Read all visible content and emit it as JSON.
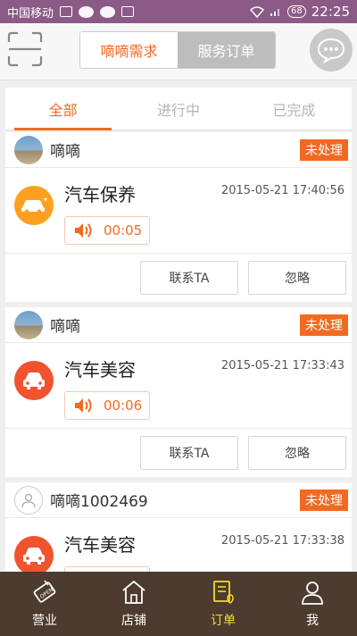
{
  "status_bar": {
    "carrier": "中国移动",
    "battery": "68",
    "time": "22:25"
  },
  "header": {
    "segments": [
      {
        "label": "嘀嘀需求",
        "active": true
      },
      {
        "label": "服务订单",
        "active": false
      }
    ]
  },
  "tabs": [
    {
      "label": "全部",
      "active": true
    },
    {
      "label": "进行中",
      "active": false
    },
    {
      "label": "已完成",
      "active": false
    }
  ],
  "orders": [
    {
      "user": "嘀嘀",
      "status": "未处理",
      "service": "汽车保养",
      "time": "2015-05-21 17:40:56",
      "voice": "00:05",
      "contact_label": "联系TA",
      "ignore_label": "忽略"
    },
    {
      "user": "嘀嘀",
      "status": "未处理",
      "service": "汽车美容",
      "time": "2015-05-21 17:33:43",
      "voice": "00:06",
      "contact_label": "联系TA",
      "ignore_label": "忽略"
    },
    {
      "user": "嘀嘀1002469",
      "status": "未处理",
      "service": "汽车美容",
      "time": "2015-05-21 17:33:38"
    }
  ],
  "bottom_nav": [
    {
      "label": "营业",
      "icon": "open-sign-icon",
      "active": false
    },
    {
      "label": "店铺",
      "icon": "store-icon",
      "active": false
    },
    {
      "label": "订单",
      "icon": "order-icon",
      "active": true
    },
    {
      "label": "我",
      "icon": "user-icon",
      "active": false
    }
  ],
  "colors": {
    "accent": "#f26a21",
    "status_bar": "#8c5a86",
    "nav_bg": "#4c3b2e",
    "nav_active": "#f3da2d"
  }
}
